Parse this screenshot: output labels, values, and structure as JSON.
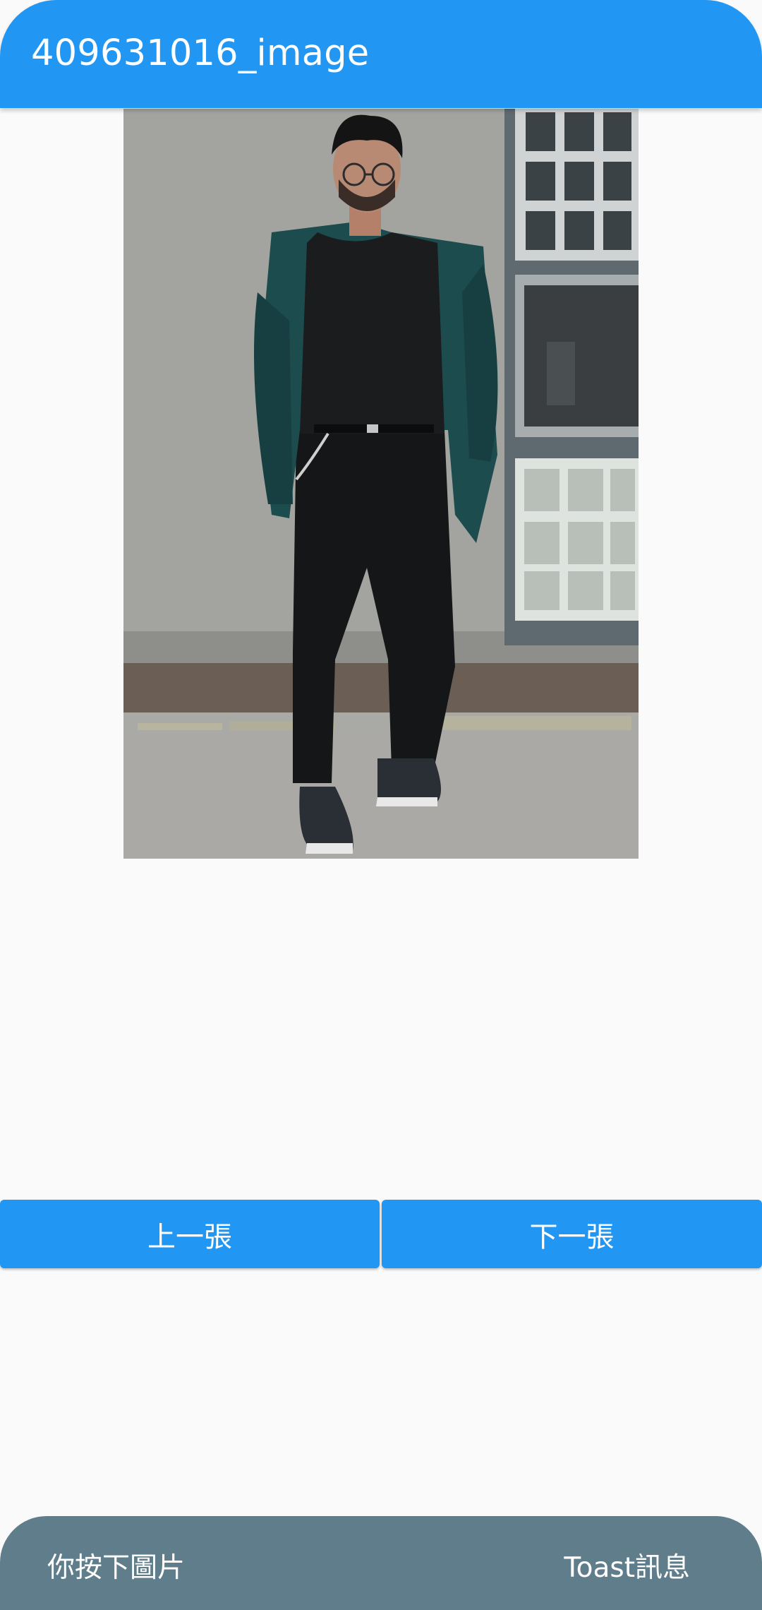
{
  "appbar": {
    "title": "409631016_image"
  },
  "image": {
    "description_icon": "photo-of-person-icon"
  },
  "buttons": {
    "prev_label": "上一張",
    "next_label": "下一張"
  },
  "bottom_bar": {
    "left_text": "你按下圖片",
    "right_text": "Toast訊息"
  },
  "colors": {
    "primary": "#2196f3",
    "bottom_bar": "#607d8b",
    "background": "#fafafa"
  }
}
